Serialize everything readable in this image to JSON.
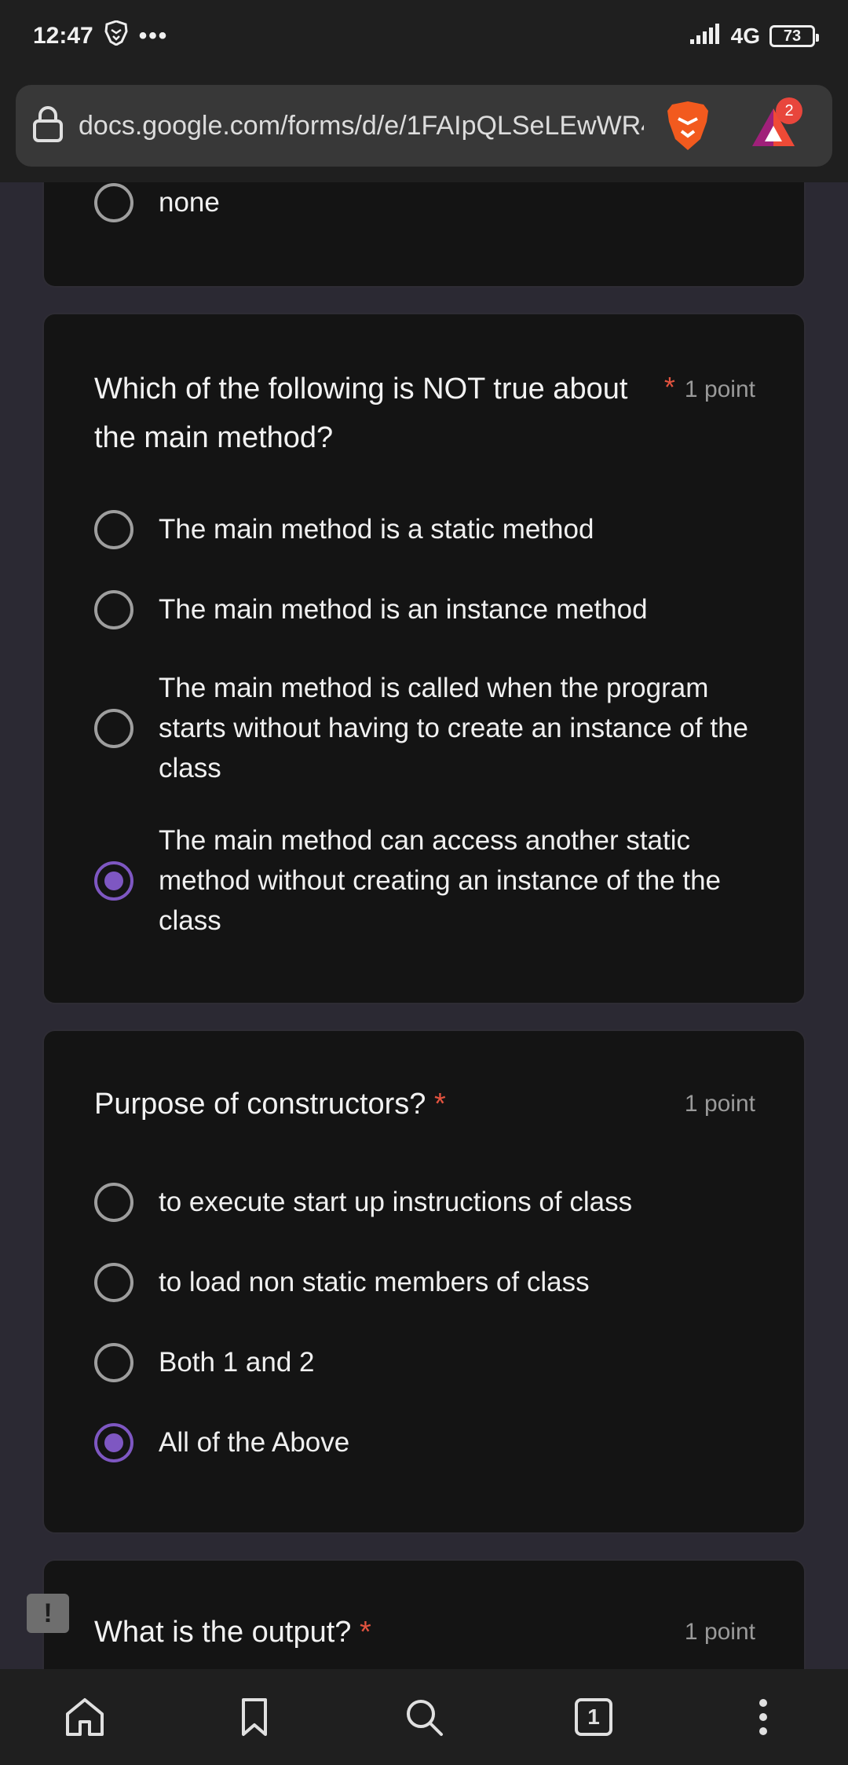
{
  "status": {
    "time": "12:47",
    "network": "4G",
    "battery": "73"
  },
  "browser": {
    "url": "docs.google.com/forms/d/e/1FAIpQLSeLEwWR4",
    "notification_count": "2"
  },
  "form": {
    "prev_option": "none",
    "q1": {
      "text": "Which of the following is NOT true about the main method?",
      "required_mark": "*",
      "points": "1 point",
      "options": [
        {
          "label": "The main method is a static method",
          "selected": false
        },
        {
          "label": "The main method is an instance method",
          "selected": false
        },
        {
          "label": "The main method is called when the program starts without having to create an instance of the class",
          "selected": false
        },
        {
          "label": "The main method can access another static method without creating an instance of the the class",
          "selected": true
        }
      ]
    },
    "q2": {
      "text": "Purpose of constructors?",
      "required_mark": "*",
      "points": "1 point",
      "options": [
        {
          "label": "to execute start up instructions of class",
          "selected": false
        },
        {
          "label": "to load non static members of class",
          "selected": false
        },
        {
          "label": "Both 1 and 2",
          "selected": false
        },
        {
          "label": "All of the Above",
          "selected": true
        }
      ]
    },
    "q3": {
      "text": "What is the output?",
      "required_mark": "*",
      "points": "1 point"
    }
  },
  "colors": {
    "accent": "#7e57c2",
    "required": "#e2533f",
    "card_bg": "#141414",
    "page_bg": "#2b2933"
  }
}
